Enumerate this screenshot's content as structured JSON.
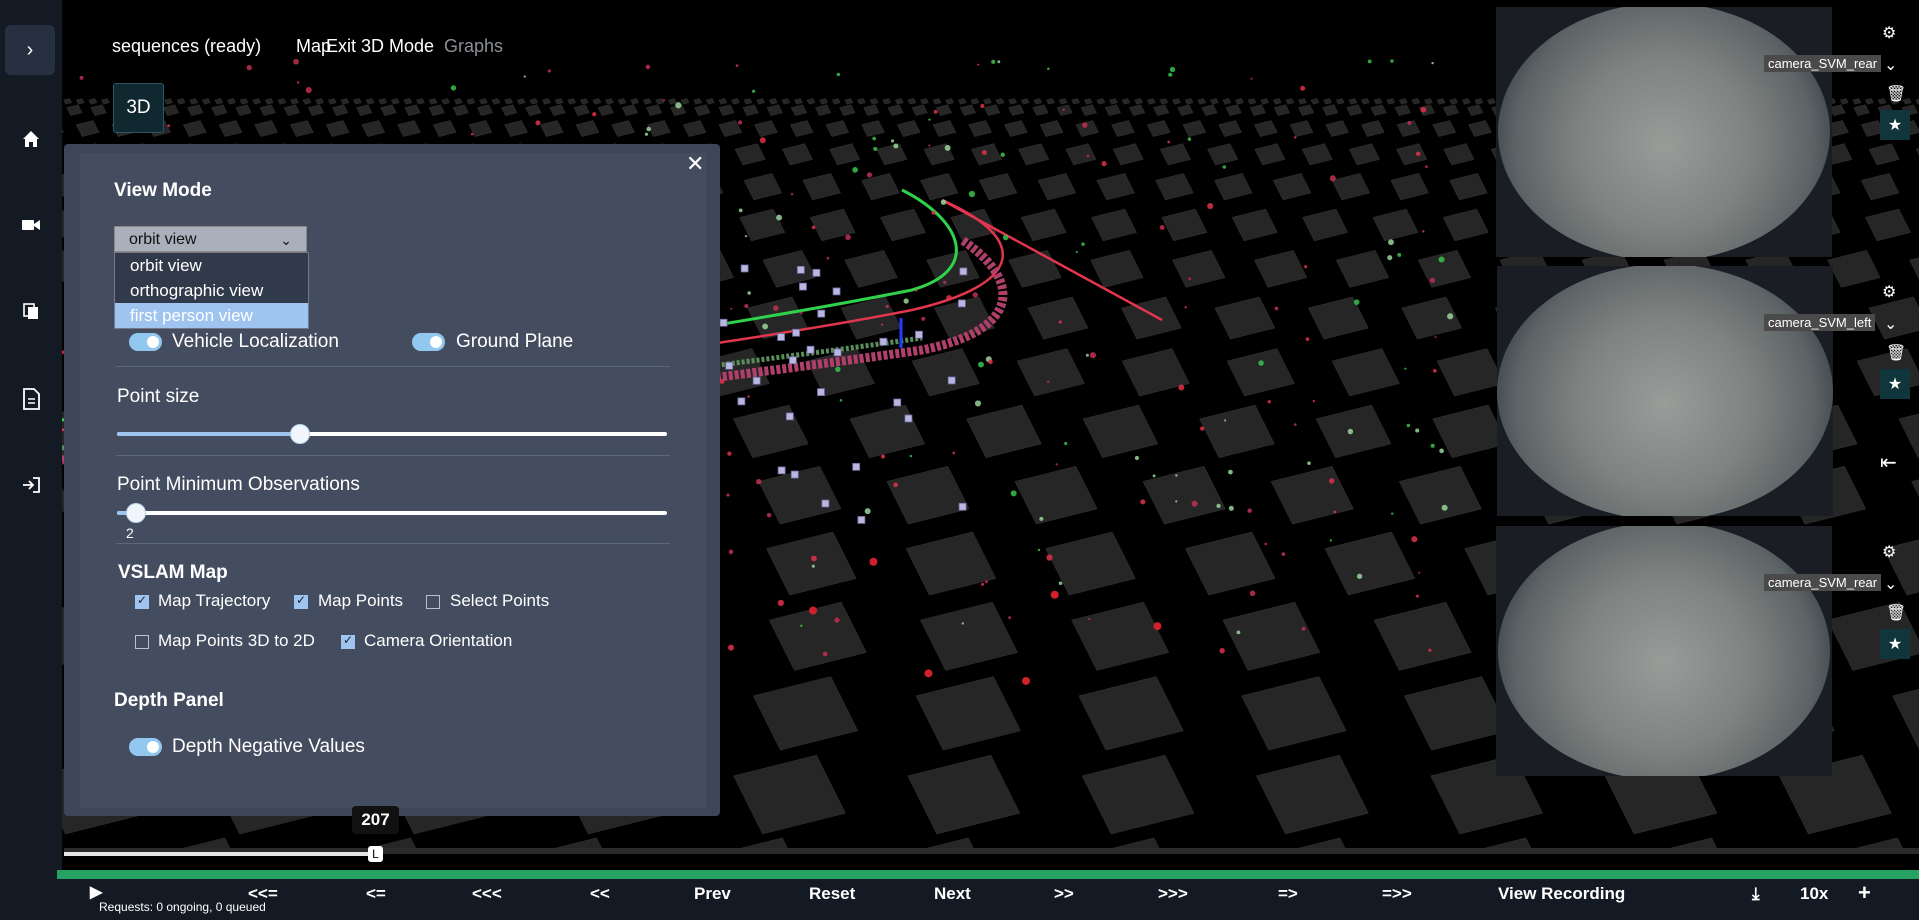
{
  "header": {
    "status": "sequences (ready)",
    "tab_map": "Map",
    "tab_exit_3d": "Exit 3D Mode",
    "tab_graphs": "Graphs",
    "mode_button": "3D"
  },
  "sidebar": {
    "toggle": "›",
    "items": [
      {
        "icon": "home-icon"
      },
      {
        "icon": "video-camera-icon"
      },
      {
        "icon": "copy-icon"
      },
      {
        "icon": "document-icon"
      },
      {
        "icon": "login-icon"
      }
    ]
  },
  "settings": {
    "close": "✕",
    "view_mode_heading": "View Mode",
    "view_mode_selected": "orbit view",
    "view_mode_options": [
      "orbit view",
      "orthographic view",
      "first person view"
    ],
    "vehicle_localization": "Vehicle Localization",
    "ground_plane": "Ground Plane",
    "point_size_label": "Point size",
    "point_size_value": 0.33,
    "min_obs_label": "Point Minimum Observations",
    "min_obs_value": "2",
    "vslam_heading": "VSLAM Map",
    "checkboxes": {
      "map_trajectory": "Map Trajectory",
      "map_points": "Map Points",
      "select_points": "Select Points",
      "map_points_3d_2d": "Map Points 3D to 2D",
      "camera_orientation": "Camera Orientation"
    },
    "depth_heading": "Depth Panel",
    "depth_negative": "Depth Negative Values"
  },
  "cameras": [
    {
      "name": "camera_SVM_rear"
    },
    {
      "name": "camera_SVM_left"
    },
    {
      "name": "camera_SVM_rear"
    }
  ],
  "timeline": {
    "frame": "207",
    "progress": 0.17
  },
  "controls": {
    "play": "▶",
    "b1": "<<=",
    "b2": "<=",
    "b3": "<<<",
    "b4": "<<",
    "prev": "Prev",
    "reset": "Reset",
    "next": "Next",
    "f1": ">>",
    "f2": ">>>",
    "f3": "=>",
    "f4": "=>>",
    "view_recording": "View Recording",
    "speed": "10x",
    "add": "+",
    "requests": "Requests: 0 ongoing, 0 queued"
  }
}
